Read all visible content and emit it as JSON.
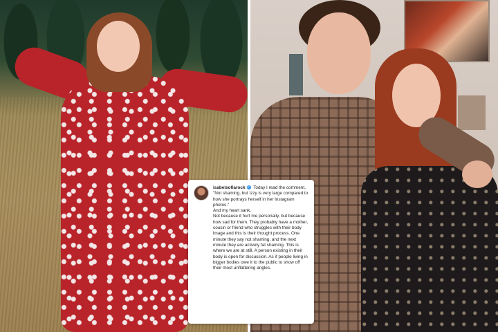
{
  "comment": {
    "username": "isabelsofiarock",
    "paragraphs": [
      "Today I read the comment, \"Not shaming, but Izzy is very large compared to how she portrays herself in her Instagram photos.\"",
      "And my heart sank.",
      "Not because it hurt me personally, but because how sad for them. They probably have a mother, cousin or friend who struggles with their body image and this is their thought process. One minute they say not shaming, and the next minute they are actively fat shaming. This is where we are at still. A person existing in their body is open for discussion. As if people living in bigger bodies owe it to the public to show off their most unflattering angles."
    ]
  },
  "icons": {
    "verified": "verified-badge-icon",
    "avatar": "profile-avatar"
  },
  "colors": {
    "verified_blue": "#3897f0",
    "dress_red": "#b8242a"
  }
}
